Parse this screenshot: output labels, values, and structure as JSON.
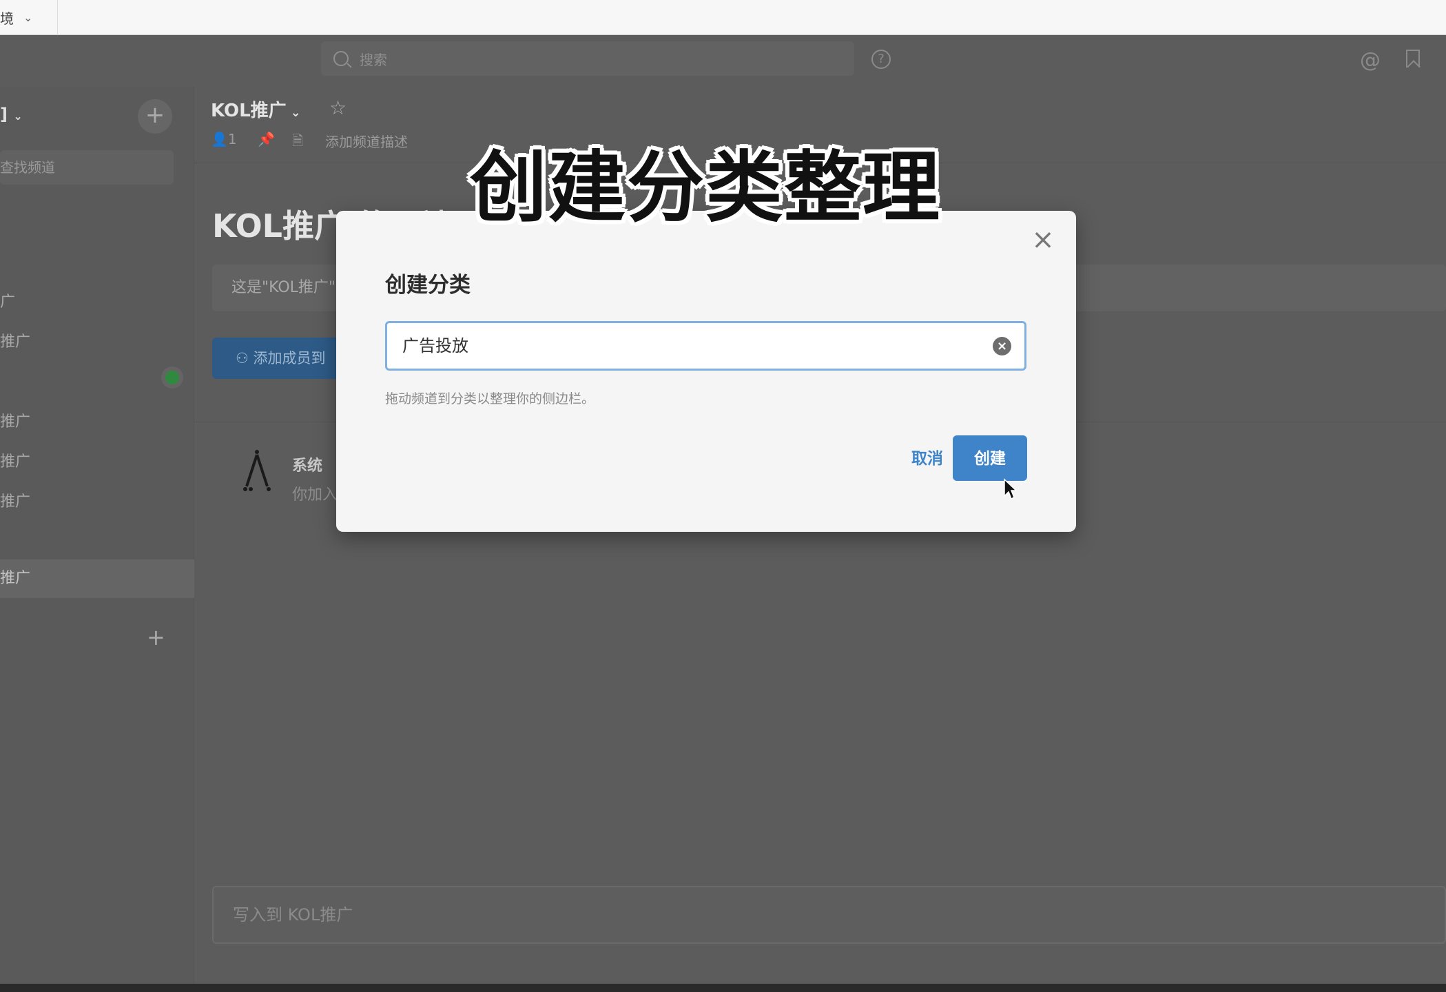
{
  "topbar": {
    "workspace_label": "境"
  },
  "header": {
    "search_placeholder": "搜索"
  },
  "sidebar": {
    "team_name": "]",
    "find_channel": "查找频道",
    "items": [
      "广",
      "推广",
      "推广",
      "推广",
      "推广"
    ],
    "active_item": "推广",
    "add_symbol": "+"
  },
  "channel": {
    "title": "KOL推广",
    "member_count": "1",
    "add_description": "添加频道描述",
    "intro_title": "KOL推广 的开端",
    "intro_desc": "这是\"KOL推广\"",
    "add_member": "添加成员到",
    "system_name": "系统",
    "system_msg": "你加入",
    "composer_placeholder": "写入到 KOL推广"
  },
  "caption": "创建分类整理",
  "modal": {
    "title": "创建分类",
    "input_value": "广告投放",
    "help_text": "拖动频道到分类以整理你的侧边栏。",
    "cancel_label": "取消",
    "create_label": "创建"
  },
  "colors": {
    "accent": "#3f84c9",
    "overlay": "#5c5c5c",
    "modal_bg": "#f5f5f5",
    "online": "#2f8a3f"
  }
}
